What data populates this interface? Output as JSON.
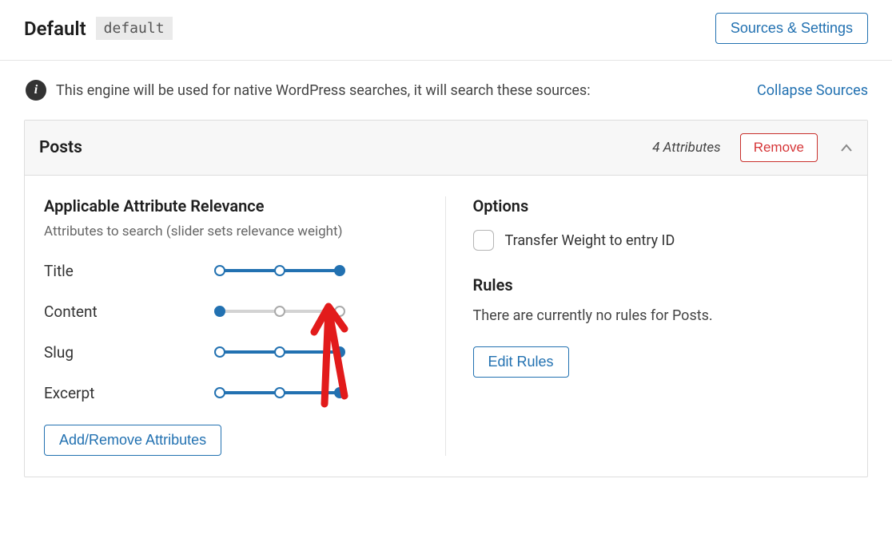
{
  "header": {
    "title": "Default",
    "slug": "default",
    "sources_btn": "Sources & Settings"
  },
  "info": {
    "text": "This engine will be used for native WordPress searches, it will search these sources:",
    "collapse_link": "Collapse Sources"
  },
  "panel": {
    "title": "Posts",
    "attr_count": "4 Attributes",
    "remove_btn": "Remove"
  },
  "left": {
    "title": "Applicable Attribute Relevance",
    "subtitle": "Attributes to search (slider sets relevance weight)",
    "attributes": [
      {
        "label": "Title",
        "value": 100,
        "handle_filled": true
      },
      {
        "label": "Content",
        "value": 0,
        "handle_filled": true
      },
      {
        "label": "Slug",
        "value": 100,
        "handle_filled": true
      },
      {
        "label": "Excerpt",
        "value": 100,
        "handle_filled": true
      }
    ],
    "add_remove_btn": "Add/Remove Attributes"
  },
  "right": {
    "options_title": "Options",
    "transfer_weight_label": "Transfer Weight to entry ID",
    "transfer_weight_checked": false,
    "rules_title": "Rules",
    "no_rules_text": "There are currently no rules for Posts.",
    "edit_rules_btn": "Edit Rules"
  }
}
